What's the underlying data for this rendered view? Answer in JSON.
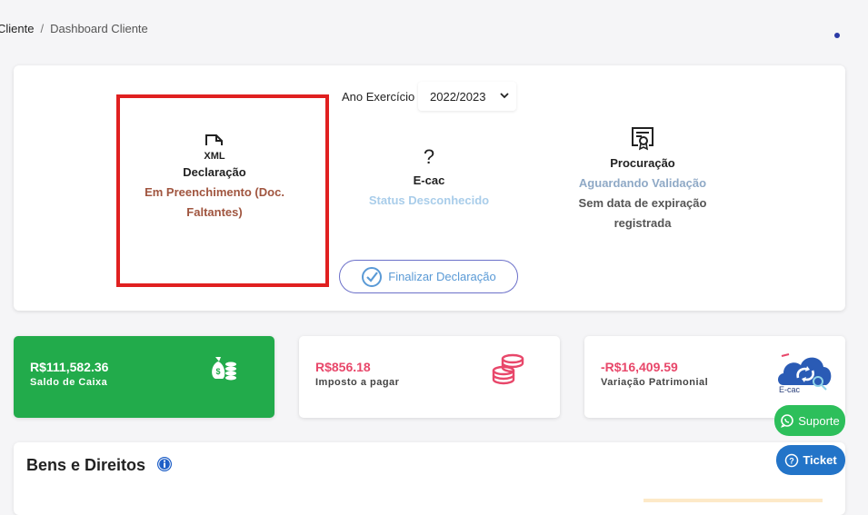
{
  "breadcrumb": {
    "first": "Cliente",
    "separator": "/",
    "current": "Dashboard Cliente"
  },
  "exercise": {
    "label": "Ano Exercício",
    "selected": "2022/2023"
  },
  "declaracao": {
    "icon": "xml-file-icon",
    "title": "Declaração",
    "status_line1": "Em Preenchimento (Doc.",
    "status_line2": "Faltantes)",
    "status_color": "#a0553f"
  },
  "ecac": {
    "icon": "question-mark-icon",
    "icon_text": "?",
    "title": "E-cac",
    "status": "Status Desconhecido",
    "status_color": "#a9cdea"
  },
  "procuracao": {
    "icon": "certificate-icon",
    "title": "Procuração",
    "status": "Aguardando Validação",
    "status_color": "#8fa9c6",
    "expiry_line1": "Sem data de expiração",
    "expiry_line2": "registrada"
  },
  "finalize_button": {
    "label": "Finalizar Declaração"
  },
  "stats": {
    "saldo": {
      "value": "R$111,582.36",
      "label": "Saldo de Caixa",
      "bg": "#22ab4b",
      "icon": "money-bag-icon"
    },
    "imposto": {
      "value": "R$856.18",
      "label": "Imposto a pagar",
      "color": "#e8476a",
      "icon": "coins-stack-icon"
    },
    "variacao": {
      "value": "-R$16,409.59",
      "label": "Variação Patrimonial",
      "color": "#e8476a",
      "icon": "ecac-cloud-icon",
      "icon_caption": "E-cac"
    }
  },
  "bens": {
    "title": "Bens e Direitos"
  },
  "floating": {
    "suporte": "Suporte",
    "ticket": "Ticket"
  }
}
